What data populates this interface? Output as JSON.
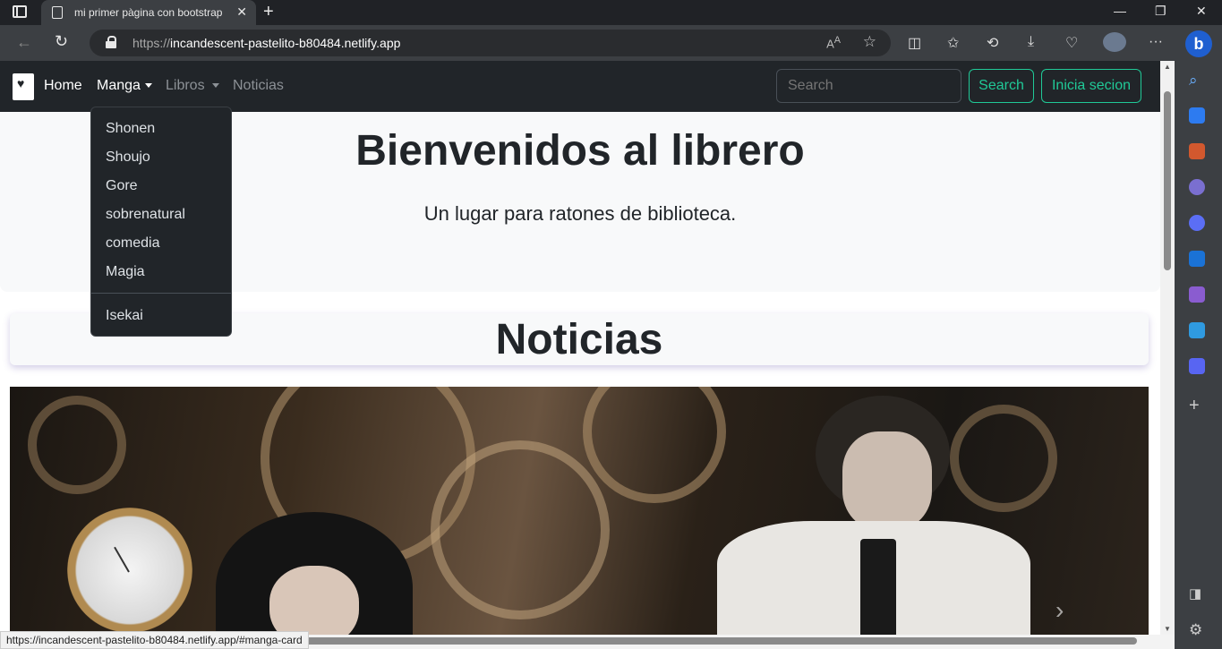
{
  "browser": {
    "tab_title": "mi primer pàgina con bootstrap",
    "url_prefix": "https://",
    "url_host": "incandescent-pastelito-b80484.netlify.app",
    "status_url": "https://incandescent-pastelito-b80484.netlify.app/#manga-card"
  },
  "navbar": {
    "home": "Home",
    "manga": "Manga",
    "libros": "Libros",
    "noticias": "Noticias",
    "search_placeholder": "Search",
    "search_button": "Search",
    "login_button": "Inicia secion"
  },
  "dropdown": {
    "items": [
      "Shonen",
      "Shoujo",
      "Gore",
      "sobrenatural",
      "comedia",
      "Magia"
    ],
    "extra": "Isekai"
  },
  "hero": {
    "title": "Bienvenidos al librero",
    "subtitle": "Un lugar para ratones de biblioteca."
  },
  "news": {
    "heading": "Noticias"
  },
  "colors": {
    "navbar": "#212529",
    "accent": "#20c997",
    "hero_bg": "#f8f9fa"
  }
}
